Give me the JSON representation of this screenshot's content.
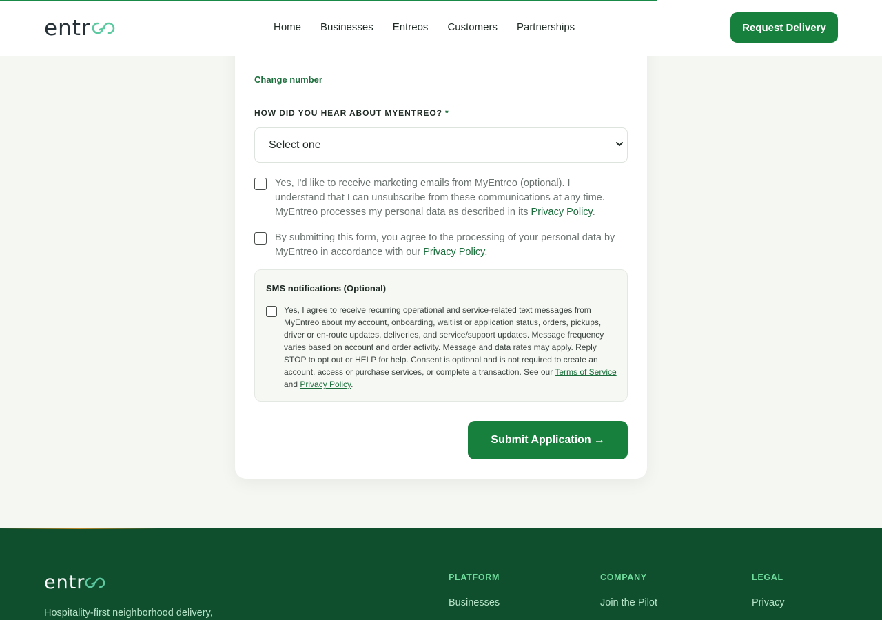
{
  "header": {
    "logo_text": "entr",
    "nav": [
      "Home",
      "Businesses",
      "Entreos",
      "Customers",
      "Partnerships"
    ],
    "cta_label": "Request Delivery"
  },
  "form": {
    "change_number": "Change number",
    "hear_label": "HOW DID YOU HEAR ABOUT MYENTREO?",
    "required_mark": "*",
    "select_value": "Select one",
    "marketing_text": "Yes, I'd like to receive marketing emails from MyEntreo (optional). I understand that I can unsubscribe from these communications at any time. MyEntreo processes my personal data as described in its ",
    "marketing_link": "Privacy Policy",
    "consent_text": "By submitting this form, you agree to the processing of your personal data by MyEntreo in accordance with our ",
    "consent_link": "Privacy Policy",
    "period": ".",
    "sms": {
      "title": "SMS notifications (Optional)",
      "text": "Yes, I agree to receive recurring operational and service-related text messages from MyEntreo about my account, onboarding, waitlist or application status, orders, pickups, driver or en-route updates, deliveries, and service/support updates. Message frequency varies based on account and order activity. Message and data rates may apply. Reply STOP to opt out or HELP for help. Consent is optional and is not required to create an account, access or purchase services, or complete a transaction. See our ",
      "terms_link": "Terms of Service",
      "and_text": " and ",
      "privacy_link": "Privacy Policy"
    },
    "submit_label": "Submit Application",
    "submit_arrow": "→"
  },
  "footer": {
    "logo_text": "entr",
    "tagline": "Hospitality-first neighborhood delivery,",
    "columns": [
      {
        "heading": "PLATFORM",
        "link": "Businesses"
      },
      {
        "heading": "COMPANY",
        "link": "Join the Pilot"
      },
      {
        "heading": "LEGAL",
        "link": "Privacy"
      }
    ]
  },
  "colors": {
    "brand_green": "#16803c",
    "footer_bg": "#0f4f2e",
    "logo_accent": "#5cc9a0"
  },
  "icons": {
    "logo_mark": "infinity-loop-icon",
    "select_chevron": "chevron-down-icon",
    "submit_arrow": "arrow-right-icon"
  }
}
